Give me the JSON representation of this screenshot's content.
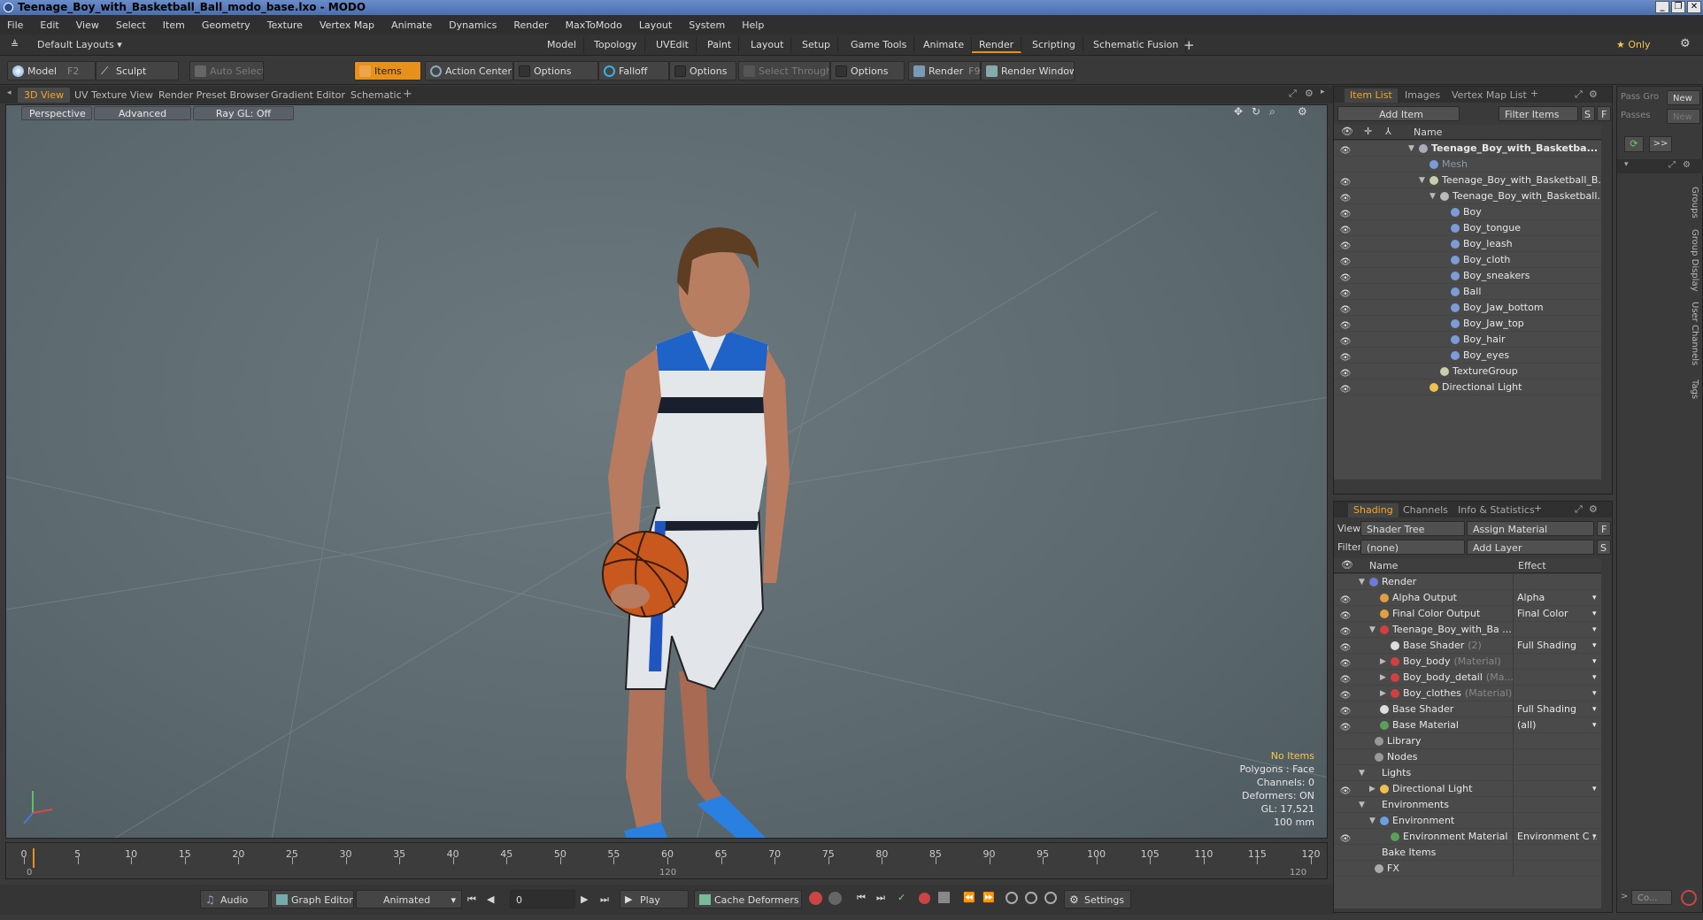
{
  "window": {
    "title": "Teenage_Boy_with_Basketball_Ball_modo_base.lxo - MODO",
    "buttons": [
      "_",
      "❐",
      "✕"
    ]
  },
  "menu": [
    "File",
    "Edit",
    "View",
    "Select",
    "Item",
    "Geometry",
    "Texture",
    "Vertex Map",
    "Animate",
    "Dynamics",
    "Render",
    "MaxToModo",
    "Layout",
    "System",
    "Help"
  ],
  "layouts": {
    "selector": "Default Layouts ▾",
    "tabs": [
      "Model",
      "Topology",
      "UVEdit",
      "Paint",
      "Layout",
      "Setup",
      "Game Tools",
      "Animate",
      "Render",
      "Scripting",
      "Schematic Fusion"
    ],
    "active": "Render",
    "plus": "+",
    "only": "★ Only"
  },
  "toolbar": {
    "model": "Model",
    "model_key": "F2",
    "sculpt": "Sculpt",
    "auto_select": "Auto Select",
    "items": "Items",
    "action_center": "Action Center",
    "options1": "Options",
    "falloff": "Falloff",
    "options2": "Options",
    "select_through": "Select Through",
    "options3": "Options",
    "render": "Render",
    "render_key": "F9",
    "render_window": "Render Window"
  },
  "viewport_tabs": [
    "3D View",
    "UV Texture View",
    "Render Preset Browser",
    "Gradient Editor",
    "Schematic"
  ],
  "viewport_tabs_active": "3D View",
  "viewport": {
    "view_mode": "Perspective",
    "advanced": "Advanced",
    "raygl": "Ray GL: Off",
    "stats": [
      "No Items",
      "Polygons : Face",
      "Channels: 0",
      "Deformers: ON",
      "GL: 17,521",
      "100 mm"
    ]
  },
  "timeline": {
    "labels": [
      0,
      5,
      10,
      15,
      20,
      25,
      30,
      35,
      40,
      45,
      50,
      55,
      60,
      65,
      70,
      75,
      80,
      85,
      90,
      95,
      100,
      105,
      110,
      115,
      120
    ],
    "start": "0",
    "mid": "120",
    "end": "120",
    "max": 120
  },
  "bottom": {
    "audio": "Audio",
    "graph_editor": "Graph Editor",
    "animated": "Animated",
    "frame": "0",
    "play": "Play",
    "cache_deformers": "Cache Deformers",
    "settings": "Settings"
  },
  "item_list": {
    "tabs": [
      "Item List",
      "Images",
      "Vertex Map List"
    ],
    "active": "Item List",
    "add_item": "Add Item",
    "filter_items": "Filter Items",
    "s": "S",
    "f": "F",
    "name_header": "Name",
    "rows": [
      {
        "label": "Teenage_Boy_with_Basketba...",
        "indent": 0,
        "bold": true,
        "eye": true,
        "arrow": "▼",
        "icon": "scene"
      },
      {
        "label": "Mesh",
        "indent": 1,
        "bold": false,
        "eye": false,
        "arrow": "",
        "icon": "mesh",
        "dim": true
      },
      {
        "label": "Teenage_Boy_with_Basketball_B...",
        "indent": 1,
        "bold": false,
        "eye": true,
        "arrow": "▼",
        "icon": "group"
      },
      {
        "label": "Teenage_Boy_with_Basketball...",
        "indent": 2,
        "bold": false,
        "eye": true,
        "arrow": "▼",
        "icon": "locator"
      },
      {
        "label": "Boy",
        "indent": 3,
        "eye": true,
        "arrow": "",
        "icon": "mesh"
      },
      {
        "label": "Boy_tongue",
        "indent": 3,
        "eye": true,
        "arrow": "",
        "icon": "mesh"
      },
      {
        "label": "Boy_leash",
        "indent": 3,
        "eye": true,
        "arrow": "",
        "icon": "mesh"
      },
      {
        "label": "Boy_cloth",
        "indent": 3,
        "eye": true,
        "arrow": "",
        "icon": "mesh"
      },
      {
        "label": "Boy_sneakers",
        "indent": 3,
        "eye": true,
        "arrow": "",
        "icon": "mesh"
      },
      {
        "label": "Ball",
        "indent": 3,
        "eye": true,
        "arrow": "",
        "icon": "mesh"
      },
      {
        "label": "Boy_Jaw_bottom",
        "indent": 3,
        "eye": true,
        "arrow": "",
        "icon": "mesh"
      },
      {
        "label": "Boy_Jaw_top",
        "indent": 3,
        "eye": true,
        "arrow": "",
        "icon": "mesh"
      },
      {
        "label": "Boy_hair",
        "indent": 3,
        "eye": true,
        "arrow": "",
        "icon": "mesh"
      },
      {
        "label": "Boy_eyes",
        "indent": 3,
        "eye": true,
        "arrow": "",
        "icon": "mesh"
      },
      {
        "label": "TextureGroup",
        "indent": 2,
        "eye": true,
        "arrow": "",
        "icon": "group"
      },
      {
        "label": "Directional Light",
        "indent": 1,
        "eye": true,
        "arrow": "",
        "icon": "light"
      }
    ]
  },
  "shading": {
    "tabs": [
      "Shading",
      "Channels",
      "Info & Statistics"
    ],
    "active": "Shading",
    "view_label": "View",
    "view_value": "Shader Tree",
    "assign_material": "Assign Material",
    "filter_label": "Filter",
    "filter_value": "(none)",
    "add_layer": "Add Layer",
    "f": "F",
    "s": "S",
    "name_header": "Name",
    "effect_header": "Effect",
    "rows": [
      {
        "label": "Render",
        "indent": 0,
        "eye": false,
        "arrow": "▼",
        "icon": "render",
        "effect": ""
      },
      {
        "label": "Alpha Output",
        "indent": 1,
        "eye": true,
        "arrow": "",
        "icon": "output",
        "effect": "Alpha"
      },
      {
        "label": "Final Color Output",
        "indent": 1,
        "eye": true,
        "arrow": "",
        "icon": "output",
        "effect": "Final Color"
      },
      {
        "label": "Teenage_Boy_with_Ba ...",
        "indent": 1,
        "eye": true,
        "arrow": "▼",
        "icon": "mat",
        "effect": ""
      },
      {
        "label": "Base Shader",
        "suffix": "(2)",
        "indent": 2,
        "eye": true,
        "arrow": "",
        "icon": "shader",
        "effect": "Full Shading"
      },
      {
        "label": "Boy_body",
        "suffix": "(Material)",
        "indent": 2,
        "eye": true,
        "arrow": "▶",
        "icon": "mat",
        "effect": ""
      },
      {
        "label": "Boy_body_detail",
        "suffix": "(Ma...",
        "indent": 2,
        "eye": true,
        "arrow": "▶",
        "icon": "mat",
        "effect": ""
      },
      {
        "label": "Boy_clothes",
        "suffix": "(Material)",
        "indent": 2,
        "eye": true,
        "arrow": "▶",
        "icon": "mat",
        "effect": ""
      },
      {
        "label": "Base Shader",
        "indent": 1,
        "eye": true,
        "arrow": "",
        "icon": "shader",
        "effect": "Full Shading"
      },
      {
        "label": "Base Material",
        "indent": 1,
        "eye": true,
        "arrow": "",
        "icon": "basemat",
        "effect": "(all)"
      },
      {
        "label": "Library",
        "indent": 0.5,
        "eye": false,
        "arrow": "",
        "icon": "folder",
        "effect": ""
      },
      {
        "label": "Nodes",
        "indent": 0.5,
        "eye": false,
        "arrow": "",
        "icon": "folder",
        "effect": ""
      },
      {
        "label": "Lights",
        "indent": 0,
        "eye": false,
        "arrow": "▼",
        "icon": "",
        "effect": ""
      },
      {
        "label": "Directional Light",
        "indent": 1,
        "eye": true,
        "arrow": "▶",
        "icon": "light",
        "effect": ""
      },
      {
        "label": "Environments",
        "indent": 0,
        "eye": false,
        "arrow": "▼",
        "icon": "",
        "effect": ""
      },
      {
        "label": "Environment",
        "indent": 1,
        "eye": false,
        "arrow": "▼",
        "icon": "env",
        "effect": ""
      },
      {
        "label": "Environment Material",
        "indent": 2,
        "eye": true,
        "arrow": "",
        "icon": "basemat",
        "effect": "Environment C ..."
      },
      {
        "label": "Bake Items",
        "indent": 0,
        "eye": false,
        "arrow": "",
        "icon": "",
        "effect": ""
      },
      {
        "label": "FX",
        "indent": 0.5,
        "eye": false,
        "arrow": "",
        "icon": "fx",
        "effect": ""
      }
    ]
  },
  "pass": {
    "pass_groups": "Pass Gro",
    "new1": "New",
    "passes": "Passes",
    "new2": "New",
    "side_tabs": [
      "Groups",
      "Group Display",
      "User Channels",
      "Tags"
    ],
    "co": "Co...",
    "more": ">>"
  }
}
